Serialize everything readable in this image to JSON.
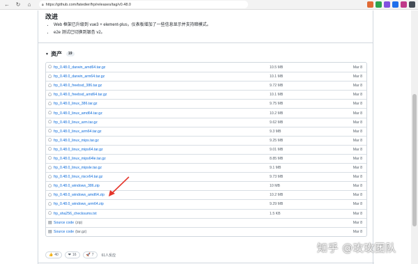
{
  "browser": {
    "url": "https://github.com/fatedier/frp/releases/tag/v0.48.0",
    "extensions": [
      {
        "icon": "ext-a-icon",
        "color": "#e06a35"
      },
      {
        "icon": "ext-b-icon",
        "color": "#2da44e"
      },
      {
        "icon": "ext-c-icon",
        "color": "#8250df"
      },
      {
        "icon": "ext-d-icon",
        "color": "#1f6feb"
      },
      {
        "icon": "ext-e-icon",
        "color": "#bf3989"
      },
      {
        "icon": "ext-f-icon",
        "color": "#444c56"
      }
    ]
  },
  "notes": {
    "title": "改进",
    "bullets": [
      "Web 框架已升级到 vue3 + element-plus，仪表板增加了一些信息显示并支持暗模式。",
      "e2e 测试已切换到银杏 v2。"
    ]
  },
  "assets": {
    "title": "资产",
    "count": "19",
    "rows": [
      {
        "name": "frp_0.48.0_darwin_amd64.tar.gz",
        "size": "10.5 MB",
        "date": "Mar 8"
      },
      {
        "name": "frp_0.48.0_darwin_arm64.tar.gz",
        "size": "10.1 MB",
        "date": "Mar 8"
      },
      {
        "name": "frp_0.48.0_freebsd_386.tar.gz",
        "size": "9.72 MB",
        "date": "Mar 8"
      },
      {
        "name": "frp_0.48.0_freebsd_amd64.tar.gz",
        "size": "10.1 MB",
        "date": "Mar 8"
      },
      {
        "name": "frp_0.48.0_linux_386.tar.gz",
        "size": "9.75 MB",
        "date": "Mar 8"
      },
      {
        "name": "frp_0.48.0_linux_amd64.tar.gz",
        "size": "10.2 MB",
        "date": "Mar 8"
      },
      {
        "name": "frp_0.48.0_linux_arm.tar.gz",
        "size": "9.62 MB",
        "date": "Mar 8"
      },
      {
        "name": "frp_0.48.0_linux_arm64.tar.gz",
        "size": "9.3 MB",
        "date": "Mar 8"
      },
      {
        "name": "frp_0.48.0_linux_mips.tar.gz",
        "size": "9.25 MB",
        "date": "Mar 8"
      },
      {
        "name": "frp_0.48.0_linux_mips64.tar.gz",
        "size": "9.01 MB",
        "date": "Mar 8"
      },
      {
        "name": "frp_0.48.0_linux_mips64le.tar.gz",
        "size": "8.85 MB",
        "date": "Mar 8"
      },
      {
        "name": "frp_0.48.0_linux_mipsle.tar.gz",
        "size": "9.1 MB",
        "date": "Mar 8"
      },
      {
        "name": "frp_0.48.0_linux_riscv64.tar.gz",
        "size": "9.73 MB",
        "date": "Mar 8"
      },
      {
        "name": "frp_0.48.0_windows_386.zip",
        "size": "10 MB",
        "date": "Mar 8"
      },
      {
        "name": "frp_0.48.0_windows_amd64.zip",
        "size": "10.2 MB",
        "date": "Mar 8"
      },
      {
        "name": "frp_0.48.0_windows_arm64.zip",
        "size": "9.29 MB",
        "date": "Mar 8"
      },
      {
        "name": "frp_sha256_checksums.txt",
        "size": "1.5 KB",
        "date": "Mar 8"
      }
    ],
    "sources": [
      {
        "name": "Source code",
        "suffix": "(zip)",
        "date": "Mar 8"
      },
      {
        "name": "Source code",
        "suffix": "(tar.gz)",
        "date": "Mar 8"
      }
    ]
  },
  "reactions": {
    "items": [
      {
        "emoji": "👍",
        "count": "40"
      },
      {
        "emoji": "❤",
        "count": "16"
      },
      {
        "emoji": "🚀",
        "count": "7"
      }
    ],
    "total": "61人反应"
  },
  "watermark": "知乎 @玫玫团队",
  "accent": {
    "link": "#0969da",
    "arrow": "#e5352b"
  }
}
